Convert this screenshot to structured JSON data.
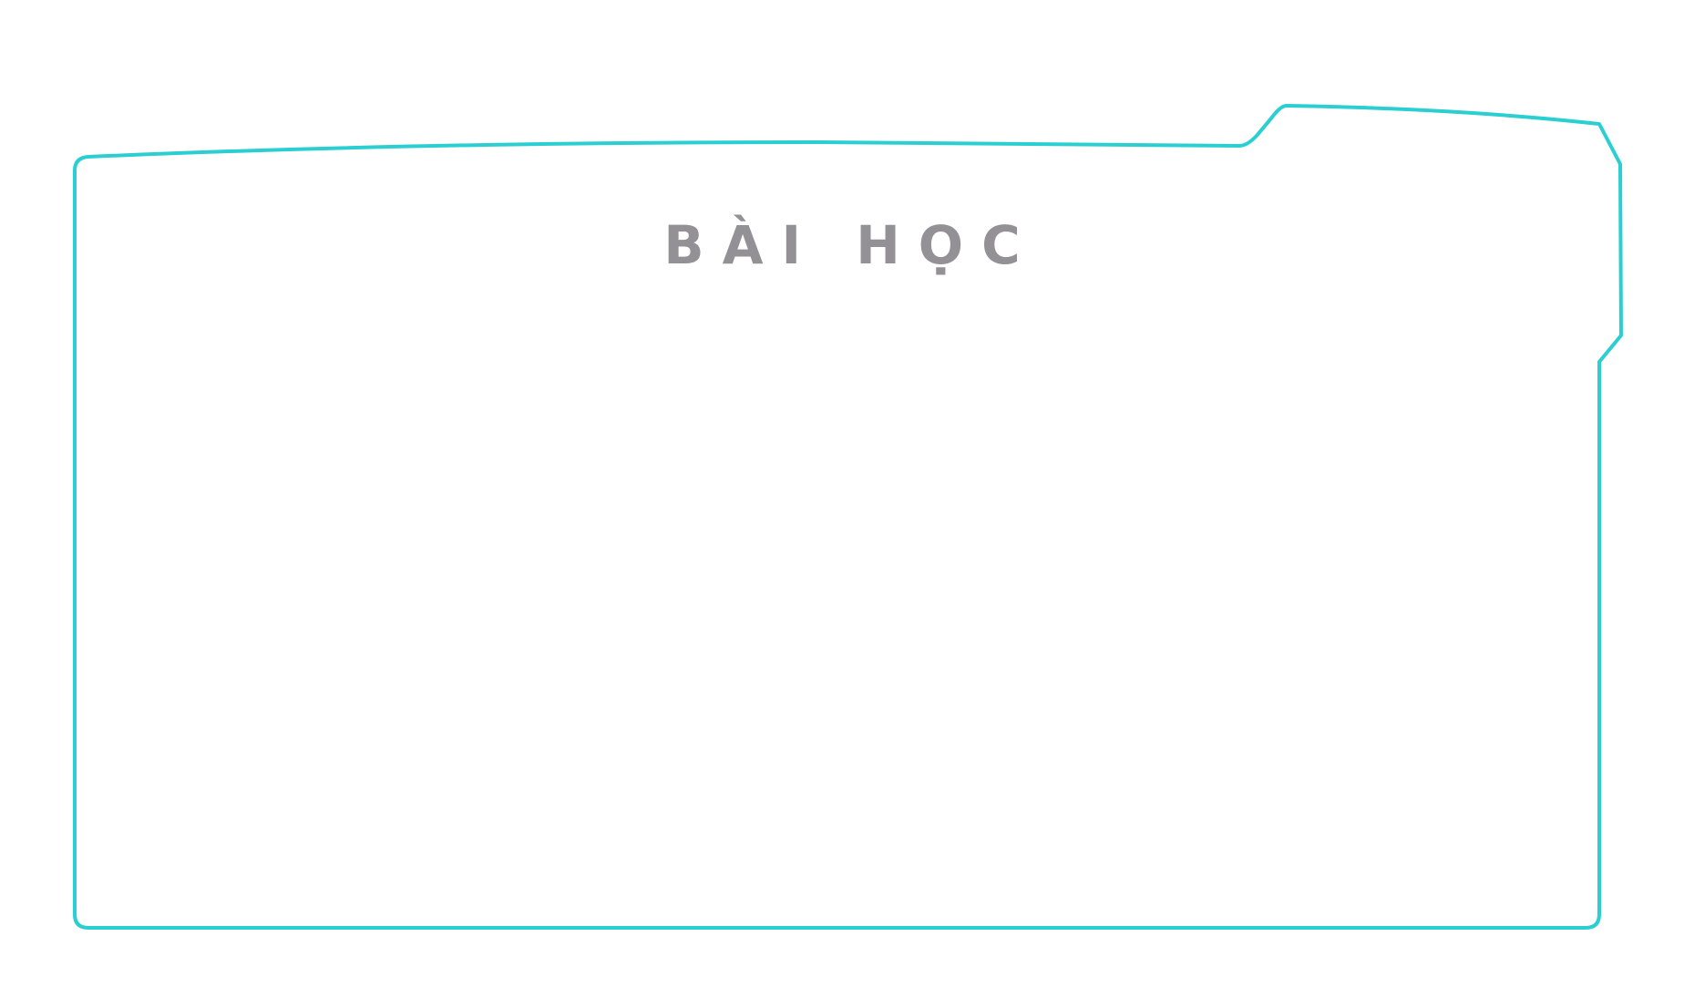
{
  "title": "BÀI HỌC",
  "colors": {
    "frame": "#2ccfd1",
    "title": "#939195",
    "background": "#ffffff"
  }
}
